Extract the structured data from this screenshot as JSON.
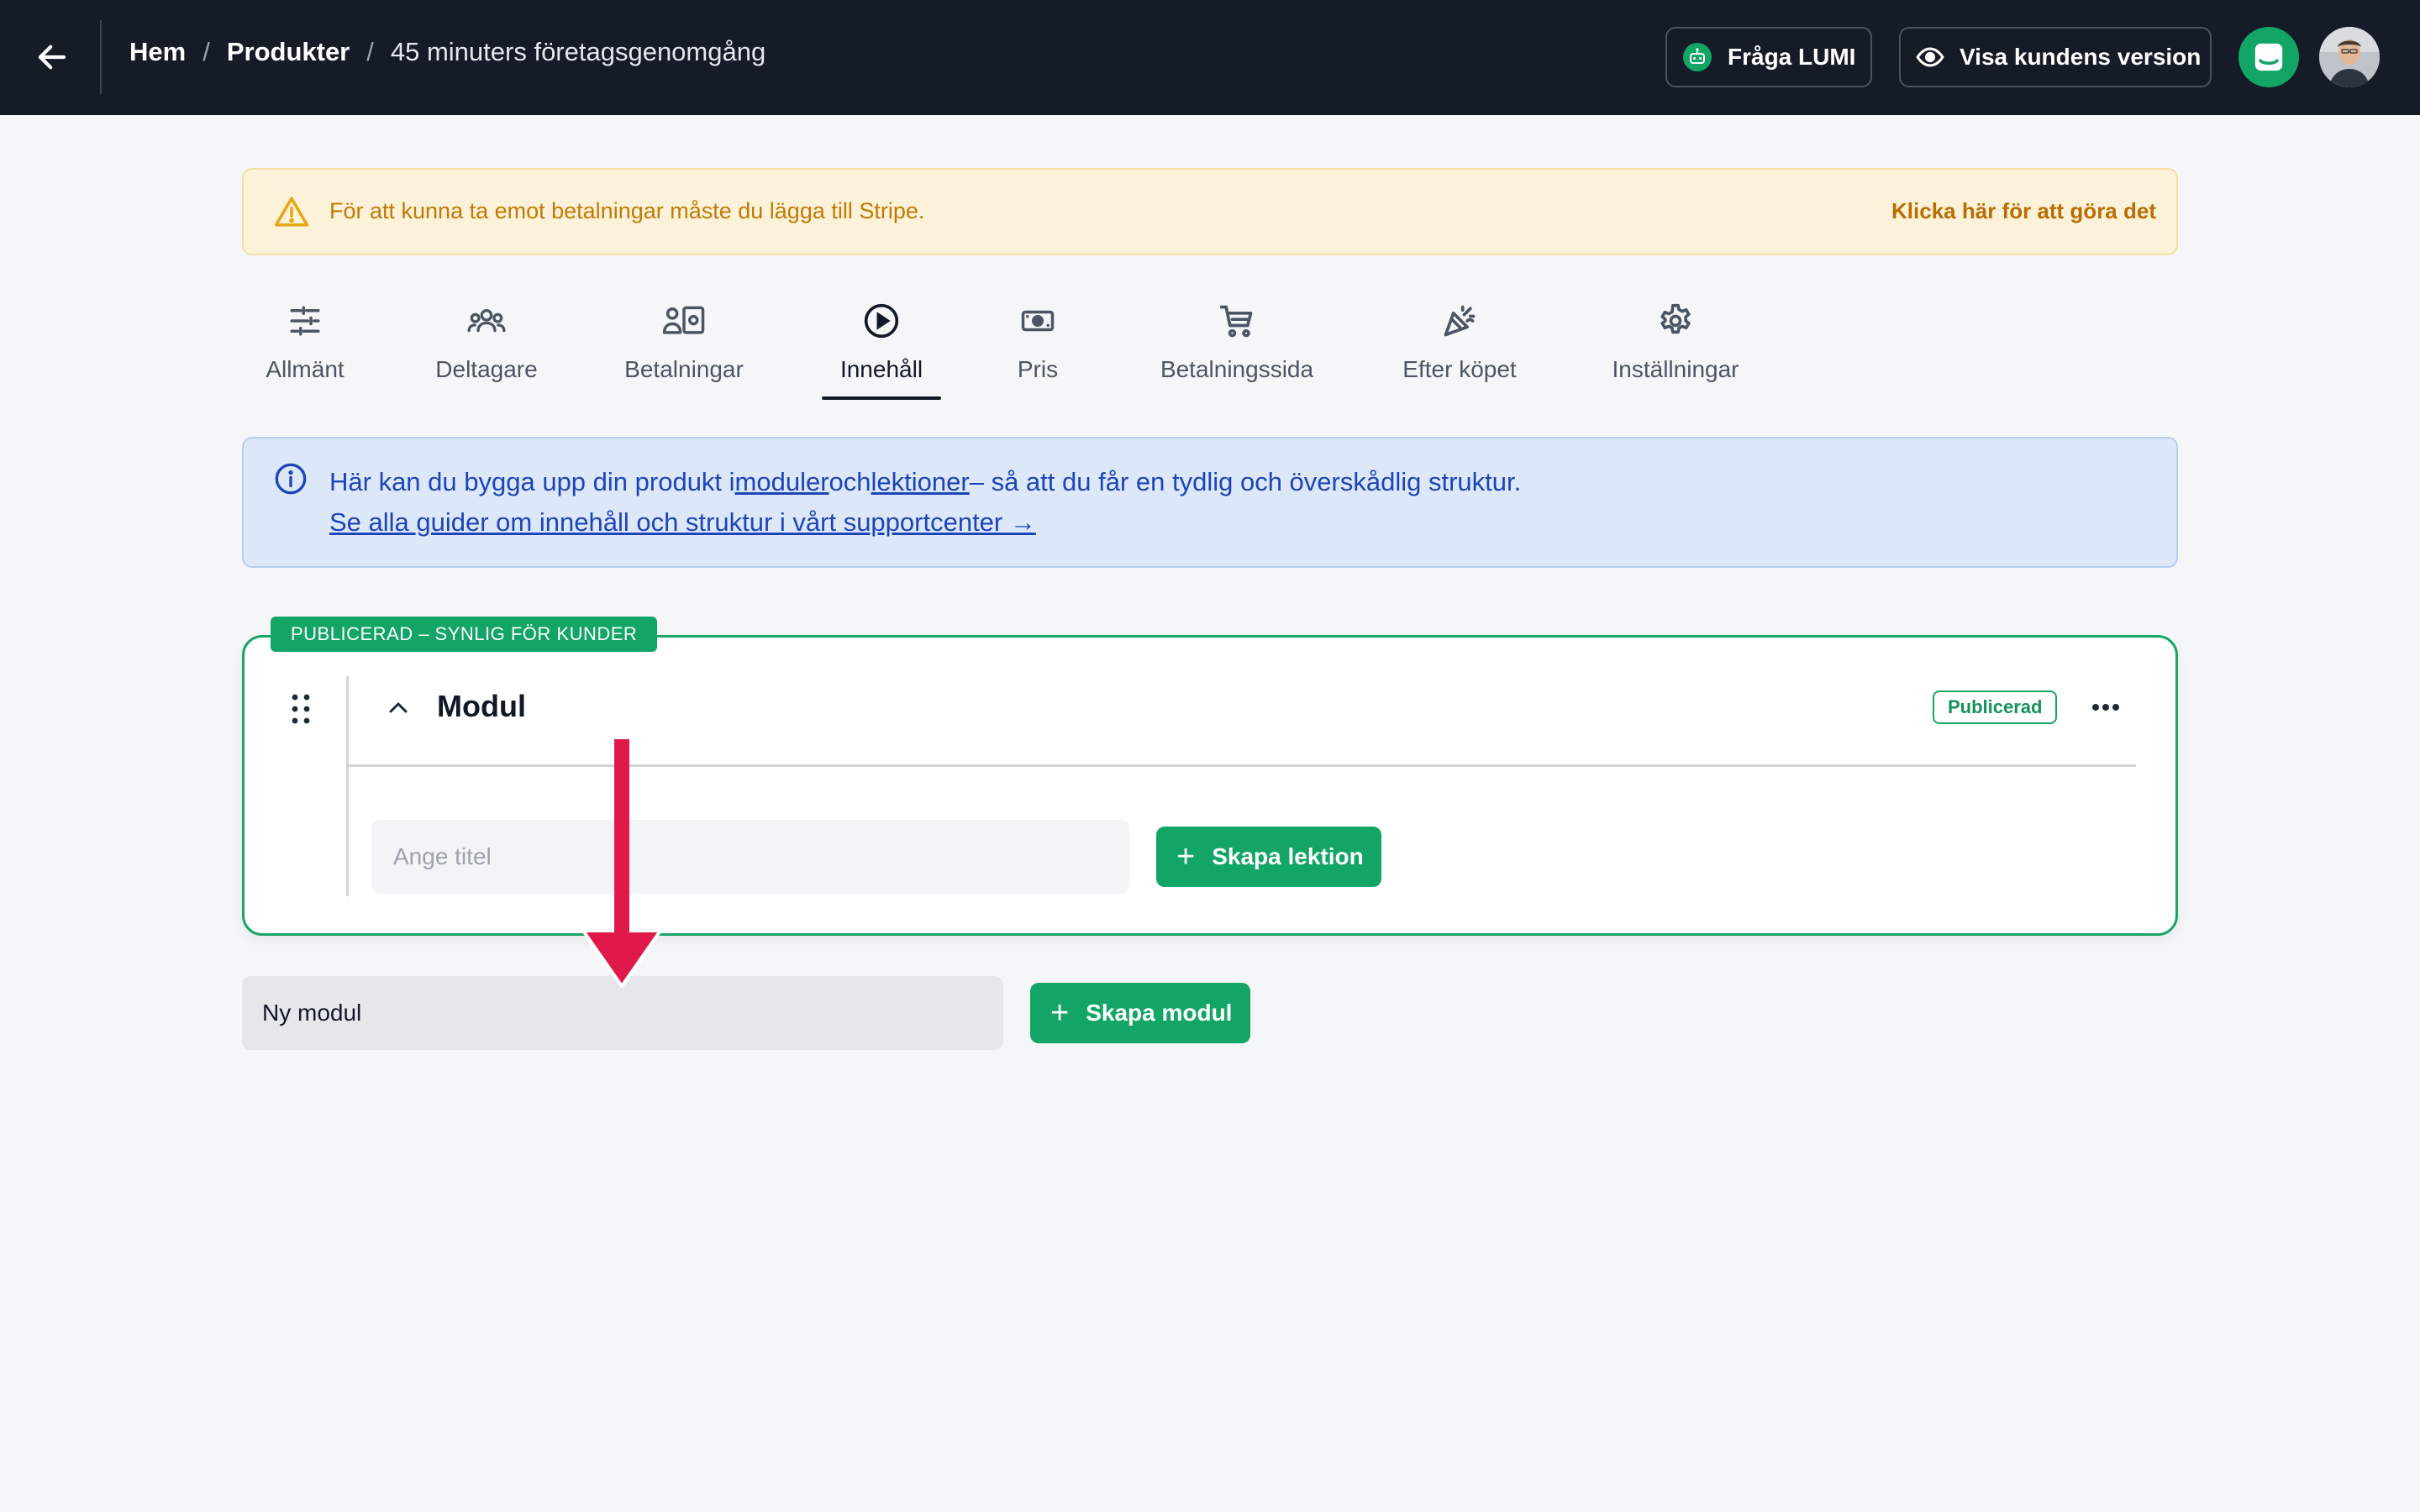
{
  "header": {
    "breadcrumb": [
      "Hem",
      "Produkter",
      "45 minuters företagsgenomgång"
    ],
    "ask_lumi_label": "Fråga LUMI",
    "customer_view_label": "Visa kundens version"
  },
  "warning": {
    "text": "För att kunna ta emot betalningar måste du lägga till Stripe.",
    "link": "Klicka här för att göra det"
  },
  "tabs": [
    {
      "label": "Allmänt",
      "icon": "sliders-icon"
    },
    {
      "label": "Deltagare",
      "icon": "users-icon"
    },
    {
      "label": "Betalningar",
      "icon": "payments-icon"
    },
    {
      "label": "Innehåll",
      "icon": "play-circle-icon",
      "active": true
    },
    {
      "label": "Pris",
      "icon": "banknote-icon"
    },
    {
      "label": "Betalningssida",
      "icon": "cart-icon"
    },
    {
      "label": "Efter köpet",
      "icon": "party-icon"
    },
    {
      "label": "Inställningar",
      "icon": "gear-icon"
    }
  ],
  "info": {
    "prefix": "Här kan du bygga upp din produkt i",
    "link_modules": "moduler",
    "mid": "och",
    "link_lessons": "lektioner",
    "suffix": "– så att du får en tydlig och överskådlig struktur.",
    "guide_link": "Se alla guider om innehåll och struktur i vårt supportcenter →"
  },
  "module": {
    "status_tag": "PUBLICERAD – SYNLIG FÖR KUNDER",
    "title": "Modul",
    "badge": "Publicerad",
    "lesson_placeholder": "Ange titel",
    "create_lesson_label": "Skapa lektion"
  },
  "new_module": {
    "input_value": "Ny modul",
    "create_module_label": "Skapa modul"
  },
  "colors": {
    "header_bg": "#151b27",
    "accent_green": "#12a566",
    "warning_text": "#c27a04",
    "info_text": "#1d44b8",
    "annotation_arrow": "#e0194a"
  }
}
